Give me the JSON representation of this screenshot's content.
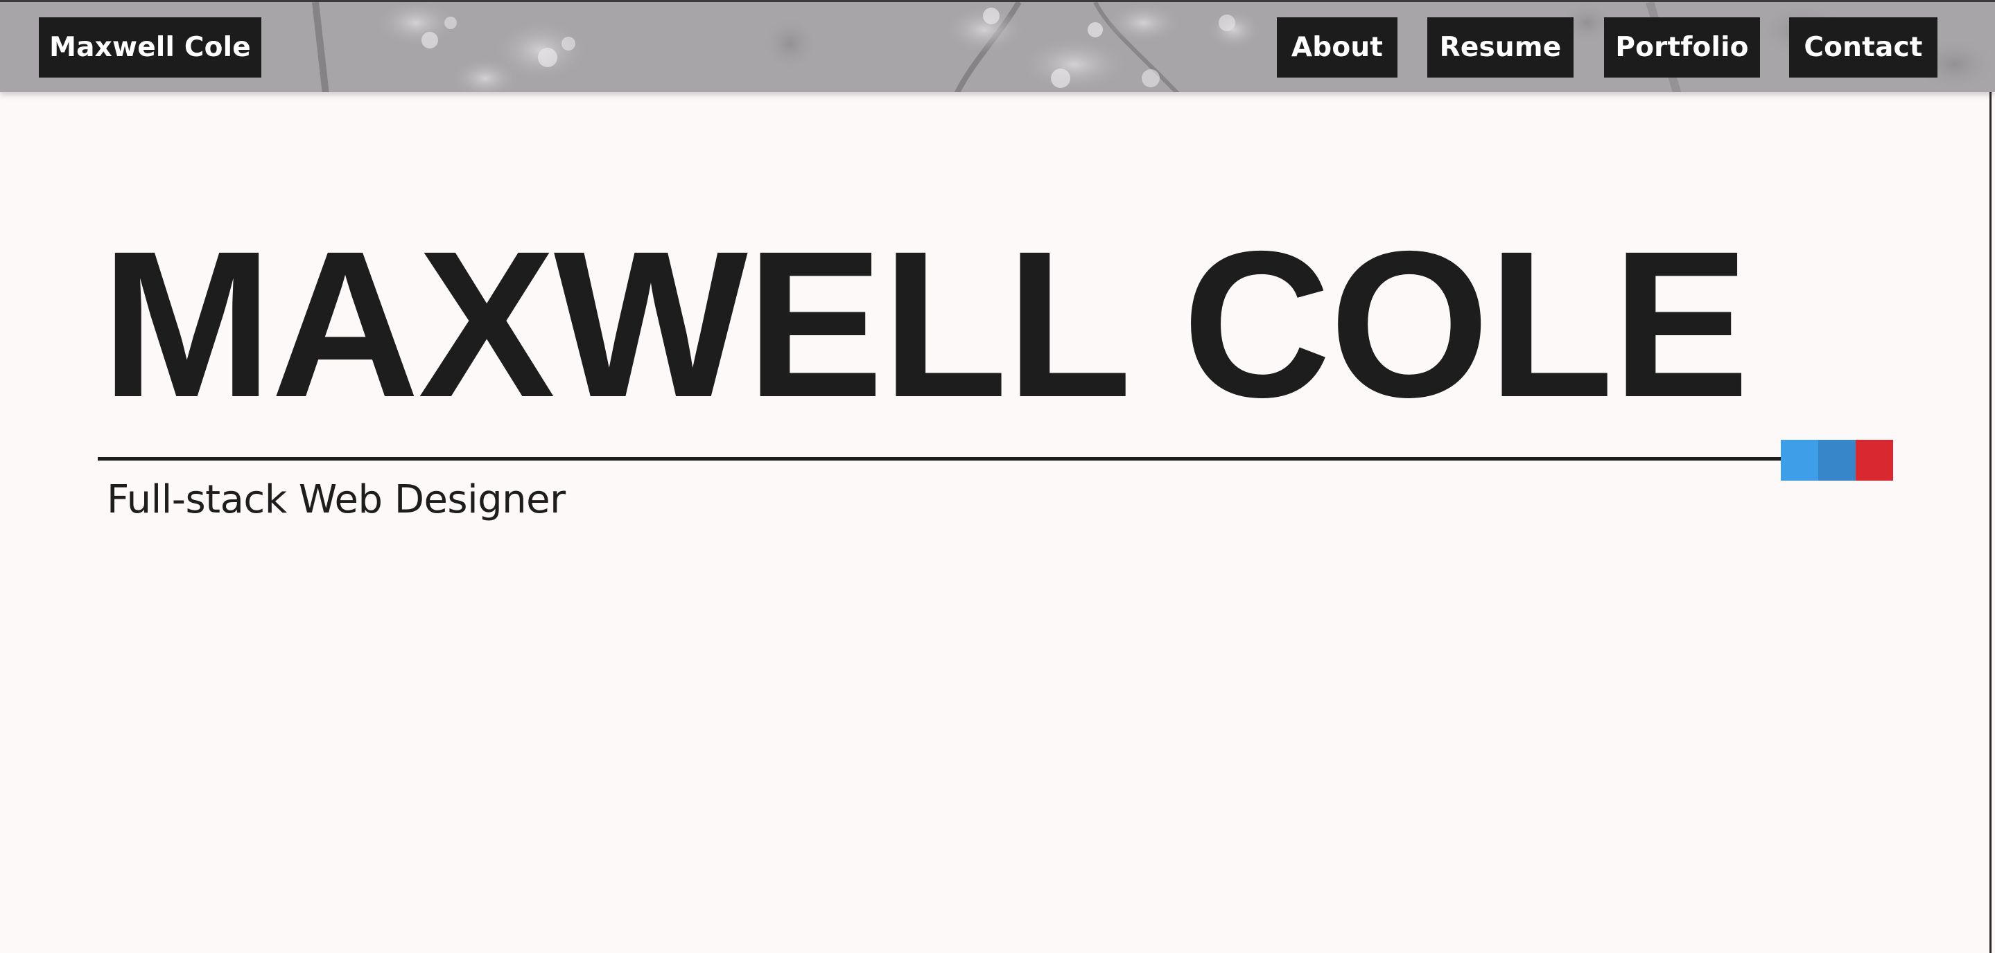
{
  "header": {
    "brand_label": "Maxwell Cole",
    "nav": [
      {
        "label": "About"
      },
      {
        "label": "Resume"
      },
      {
        "label": "Portfolio"
      },
      {
        "label": "Contact"
      }
    ]
  },
  "hero": {
    "title": "MAXWELL COLE",
    "subtitle": "Full-stack Web Designer",
    "accent_colors": [
      "#3e9ee8",
      "#3686c9",
      "#d9282f"
    ]
  },
  "colors": {
    "background": "#fcf9f8",
    "text": "#1d1d1d",
    "button_bg": "#1c1c1c",
    "button_text": "#ffffff"
  }
}
